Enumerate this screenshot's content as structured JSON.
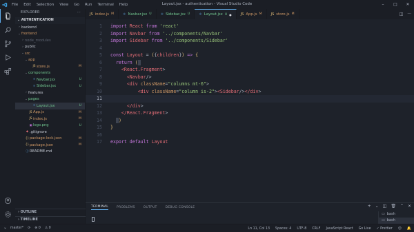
{
  "titlebar": {
    "menu": [
      "File",
      "Edit",
      "Selection",
      "View",
      "Go",
      "Run",
      "Terminal",
      "Help"
    ],
    "title": "Layout.jsx - authentication - Visual Studio Code"
  },
  "sidebar": {
    "title": "EXPLORER",
    "section": "AUTHENTICATION",
    "outline_label": "OUTLINE",
    "timeline_label": "TIMELINE",
    "tree": [
      {
        "label": "backend",
        "badge": "",
        "icon": "folder",
        "chevron": "›",
        "indent": 0,
        "color": "folder",
        "selected": false
      },
      {
        "label": "frontend",
        "badge": "",
        "icon": "folder",
        "chevron": "⌄",
        "indent": 0,
        "color": "mod",
        "selected": false
      },
      {
        "label": "node_modules",
        "badge": "",
        "icon": "folder",
        "chevron": "›",
        "indent": 1,
        "color": "dim",
        "selected": false
      },
      {
        "label": "public",
        "badge": "",
        "icon": "folder",
        "chevron": "›",
        "indent": 1,
        "color": "folder",
        "selected": false
      },
      {
        "label": "src",
        "badge": "",
        "icon": "folder",
        "chevron": "⌄",
        "indent": 1,
        "color": "mod",
        "selected": false
      },
      {
        "label": "app",
        "badge": "",
        "icon": "folder",
        "chevron": "⌄",
        "indent": 2,
        "color": "mod",
        "selected": false
      },
      {
        "label": "store.js",
        "badge": "M",
        "icon": "js",
        "chevron": "",
        "indent": 3,
        "color": "mod",
        "selected": false
      },
      {
        "label": "components",
        "badge": "",
        "icon": "folder",
        "chevron": "⌄",
        "indent": 2,
        "color": "green",
        "selected": false
      },
      {
        "label": "Navbar.jsx",
        "badge": "U",
        "icon": "jsx",
        "chevron": "",
        "indent": 3,
        "color": "green",
        "selected": false
      },
      {
        "label": "Sidebar.jsx",
        "badge": "U",
        "icon": "jsx",
        "chevron": "",
        "indent": 3,
        "color": "green",
        "selected": false
      },
      {
        "label": "features",
        "badge": "",
        "icon": "folder",
        "chevron": "›",
        "indent": 2,
        "color": "folder",
        "selected": false
      },
      {
        "label": "pages",
        "badge": "",
        "icon": "folder",
        "chevron": "⌄",
        "indent": 2,
        "color": "green",
        "selected": false
      },
      {
        "label": "Layout.jsx",
        "badge": "U",
        "icon": "jsx",
        "chevron": "",
        "indent": 3,
        "color": "green",
        "selected": true
      },
      {
        "label": "App.js",
        "badge": "M",
        "icon": "js",
        "chevron": "",
        "indent": 2,
        "color": "mod",
        "selected": false
      },
      {
        "label": "index.js",
        "badge": "M",
        "icon": "js",
        "chevron": "",
        "indent": 2,
        "color": "mod",
        "selected": false
      },
      {
        "label": "logo.png",
        "badge": "U",
        "icon": "img",
        "chevron": "",
        "indent": 2,
        "color": "green",
        "selected": false
      },
      {
        "label": ".gitignore",
        "badge": "",
        "icon": "git",
        "chevron": "",
        "indent": 1,
        "color": "folder",
        "selected": false
      },
      {
        "label": "package-lock.json",
        "badge": "M",
        "icon": "json",
        "chevron": "",
        "indent": 1,
        "color": "mod",
        "selected": false
      },
      {
        "label": "package.json",
        "badge": "M",
        "icon": "json",
        "chevron": "",
        "indent": 1,
        "color": "mod",
        "selected": false
      },
      {
        "label": "README.md",
        "badge": "",
        "icon": "md",
        "chevron": "",
        "indent": 1,
        "color": "folder",
        "selected": false
      }
    ]
  },
  "tabs": [
    {
      "label": "index.js",
      "status": "M",
      "icon": "js",
      "active": false
    },
    {
      "label": "Navbar.jsx",
      "status": "U",
      "icon": "jsx",
      "active": false
    },
    {
      "label": "Sidebar.jsx",
      "status": "U",
      "icon": "jsx",
      "active": false
    },
    {
      "label": "Layout.jsx",
      "status": "U",
      "icon": "jsx",
      "active": true
    },
    {
      "label": "App.js",
      "status": "M",
      "icon": "js",
      "active": false
    },
    {
      "label": "store.js",
      "status": "M",
      "icon": "js",
      "active": false
    }
  ],
  "editor": {
    "current_line": 11,
    "lines": [
      [
        [
          "kw",
          "import "
        ],
        [
          "id",
          "React "
        ],
        [
          "kw",
          "from "
        ],
        [
          "str",
          "'react'"
        ]
      ],
      [
        [
          "kw",
          "import "
        ],
        [
          "id",
          "Navbar "
        ],
        [
          "kw",
          "from "
        ],
        [
          "str",
          "'../components/Navbar'"
        ]
      ],
      [
        [
          "kw",
          "import "
        ],
        [
          "id",
          "Sidebar "
        ],
        [
          "kw",
          "from "
        ],
        [
          "str",
          "'../components/Sidebar'"
        ]
      ],
      [],
      [
        [
          "kw",
          "const "
        ],
        [
          "id",
          "Layout "
        ],
        [
          "pun",
          "= "
        ],
        [
          "br",
          "("
        ],
        [
          "pun",
          "{"
        ],
        [
          "id",
          "children"
        ],
        [
          "pun",
          "}"
        ],
        [
          "br",
          ")"
        ],
        [
          "kw",
          " => "
        ],
        [
          "br",
          "{"
        ]
      ],
      [
        [
          "pun",
          "  "
        ],
        [
          "kw",
          "return "
        ],
        [
          "br",
          "("
        ]
      ],
      [
        [
          "pun",
          "    "
        ],
        [
          "tag",
          "<React.Fragment"
        ],
        [
          "pun",
          ">"
        ]
      ],
      [
        [
          "pun",
          "      "
        ],
        [
          "tag",
          "<Navbar"
        ],
        [
          "pun",
          "/>"
        ]
      ],
      [
        [
          "pun",
          "      "
        ],
        [
          "tag",
          "<div "
        ],
        [
          "attr",
          "className"
        ],
        [
          "pun",
          "="
        ],
        [
          "str",
          "\"columns mt-6\""
        ],
        [
          "pun",
          ">"
        ]
      ],
      [
        [
          "pun",
          "          "
        ],
        [
          "tag",
          "<div "
        ],
        [
          "attr",
          "className"
        ],
        [
          "pun",
          "="
        ],
        [
          "str",
          "\"column is-2\""
        ],
        [
          "pun",
          ">"
        ],
        [
          "tag",
          "<Sidebar"
        ],
        [
          "pun",
          "/>"
        ],
        [
          "tag",
          "</div"
        ],
        [
          "pun",
          ">"
        ]
      ],
      [],
      [
        [
          "pun",
          "      "
        ],
        [
          "tag",
          "</div"
        ],
        [
          "pun",
          ">"
        ]
      ],
      [
        [
          "pun",
          "    "
        ],
        [
          "tag",
          "</React.Fragment"
        ],
        [
          "pun",
          ">"
        ]
      ],
      [
        [
          "pun",
          "  "
        ],
        [
          "br",
          ")"
        ]
      ],
      [
        [
          "br",
          "}"
        ]
      ],
      [],
      [
        [
          "kw",
          "export default "
        ],
        [
          "id",
          "Layout"
        ]
      ]
    ]
  },
  "panel": {
    "tabs": [
      "TERMINAL",
      "PROBLEMS",
      "OUTPUT",
      "DEBUG CONSOLE"
    ],
    "active_tab": "TERMINAL",
    "terminals": [
      "bash",
      "bash"
    ]
  },
  "statusbar": {
    "branch": "master*",
    "sync": "⟳",
    "errors": "⊗ 0",
    "warnings": "⚠ 0",
    "right": [
      "Ln 11, Col 13",
      "Spaces: 4",
      "UTF-8",
      "CRLF",
      "JavaScript React",
      "Go Live",
      "✓ Prettier"
    ]
  },
  "colors": {
    "accent": "#61afef",
    "modified": "#d19a66",
    "untracked": "#73c991"
  }
}
